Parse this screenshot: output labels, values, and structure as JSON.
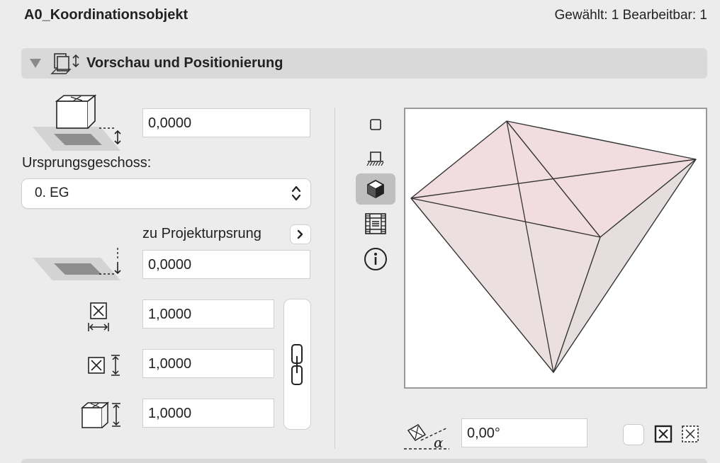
{
  "header": {
    "object_name": "A0_Koordinationsobjekt",
    "selection_info": "Gewählt: 1 Bearbeitbar: 1"
  },
  "section": {
    "title": "Vorschau und Positionierung",
    "icon": "preview-positioning-icon"
  },
  "elevation": {
    "value": "0,0000",
    "icon": "elevation-to-story-icon"
  },
  "home_story": {
    "label": "Ursprungsgeschoss:",
    "selected": "0. EG"
  },
  "project_origin": {
    "label": "zu Projekturpsrung",
    "value": "0,0000",
    "icon": "elevation-to-project-zero-icon"
  },
  "dimensions": {
    "x": {
      "value": "1,0000",
      "icon": "size-x-icon"
    },
    "y": {
      "value": "1,0000",
      "icon": "size-y-icon"
    },
    "z": {
      "value": "1,0000",
      "icon": "size-z-icon"
    },
    "link_icon": "chain-link-icon"
  },
  "preview_tools": [
    {
      "name": "floor-plan-view-icon",
      "active": false
    },
    {
      "name": "section-view-icon",
      "active": false
    },
    {
      "name": "3d-view-icon",
      "active": true
    },
    {
      "name": "list-view-icon",
      "active": false
    },
    {
      "name": "info-icon",
      "active": false
    }
  ],
  "rotation": {
    "value": "0,00°",
    "icon": "rotation-angle-icon"
  },
  "mirror": {
    "checked": false,
    "icons": [
      "mirror-on-icon",
      "mirror-off-icon"
    ]
  },
  "colors": {
    "face_top": "#f1dcdf",
    "face_left": "#ecdfe0",
    "face_right": "#e6dede"
  }
}
